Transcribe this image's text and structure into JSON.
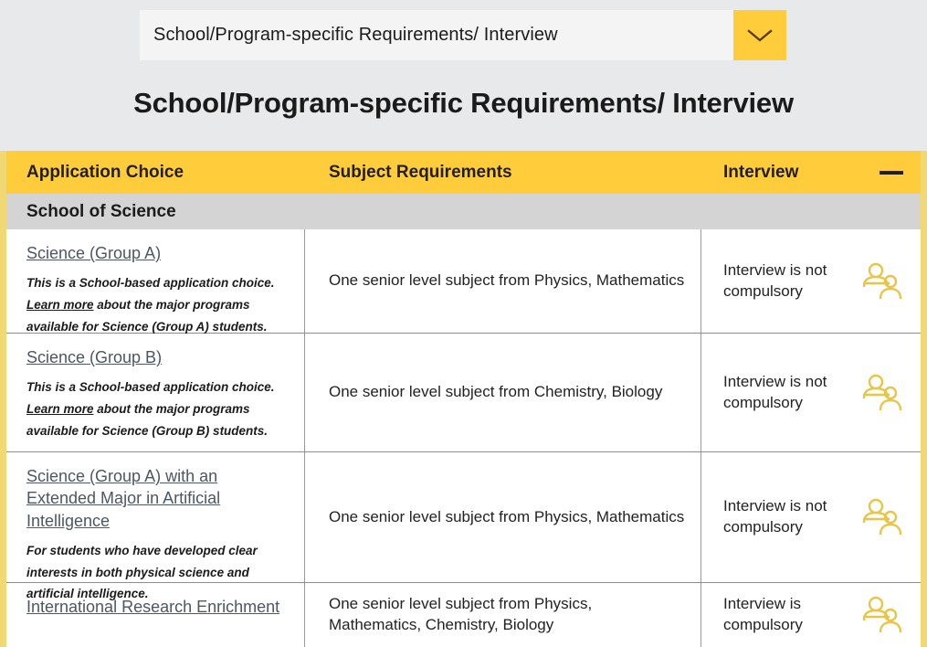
{
  "dropdown": {
    "value": "School/Program-specific Requirements/ Interview",
    "toggle_icon": "chevron-down-icon"
  },
  "page_title": "School/Program-specific Requirements/ Interview",
  "table": {
    "headers": {
      "col1": "Application Choice",
      "col2": "Subject Requirements",
      "col3": "Interview",
      "collapse_icon": "minus-icon"
    },
    "group_label": "School of Science",
    "rows": [
      {
        "choice": "Science (Group A)",
        "desc_before": "This is a School-based application choice. ",
        "desc_link": "Learn more",
        "desc_after": " about the major programs available for Science (Group A) students.",
        "subject": "One senior level subject from Physics, Mathematics",
        "interview": "Interview is not compulsory",
        "interview_icon": "people-icon"
      },
      {
        "choice": "Science (Group B)",
        "desc_before": "This is a School-based application choice. ",
        "desc_link": "Learn more",
        "desc_after": " about the major programs available for Science (Group B) students.",
        "subject": "One senior level subject from Chemistry, Biology",
        "interview": "Interview is not compulsory",
        "interview_icon": "people-icon"
      },
      {
        "choice": "Science (Group A) with an Extended Major in Artificial Intelligence",
        "desc_before": "For students who have developed clear interests in both physical science and artificial intelligence.",
        "desc_link": "",
        "desc_after": "",
        "subject": "One senior level subject from Physics, Mathematics",
        "interview": "Interview is not compulsory",
        "interview_icon": "people-icon"
      },
      {
        "choice": "International Research Enrichment",
        "desc_before": "",
        "desc_link": "",
        "desc_after": "",
        "subject": "One senior level subject from Physics, Mathematics, Chemistry, Biology",
        "interview": "Interview is compulsory",
        "interview_icon": "people-icon"
      }
    ]
  },
  "colors": {
    "accent_yellow": "#ffcd3c",
    "border_yellow": "#f1d873",
    "group_gray": "#d4d4d4",
    "page_bg": "#e8e9eb",
    "link_gray": "#4c5763"
  }
}
